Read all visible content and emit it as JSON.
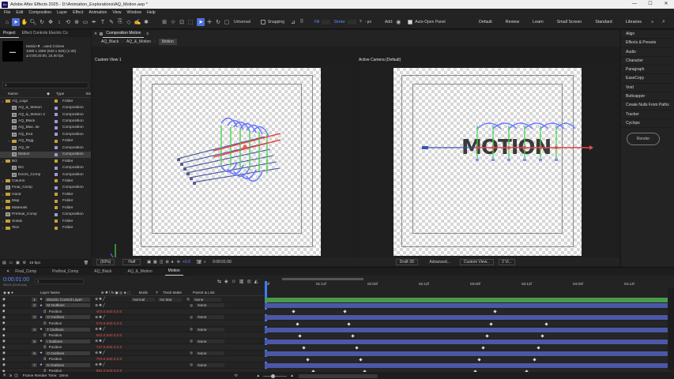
{
  "title_bar": {
    "app_badge": "Ae",
    "title": "Adobe After Effects 2025 - D:\\Animation_Explorations\\AQ_Motion.aep *",
    "controls": [
      "—",
      "☐",
      "✕"
    ]
  },
  "menu": [
    "File",
    "Edit",
    "Composition",
    "Layer",
    "Effect",
    "Animation",
    "View",
    "Window",
    "Help"
  ],
  "toolbar": {
    "universal": "Universal",
    "snapping": "Snapping",
    "fill": "Fill",
    "stroke": "Stroke",
    "stroke_help": "?",
    "stroke_px": "- px",
    "add": "Add:",
    "auto_open": "Auto-Open Panel",
    "workspaces": [
      "Default",
      "Review",
      "Learn",
      "Small Screen",
      "Standard",
      "Libraries"
    ],
    "more": "»"
  },
  "project_panel": {
    "tabs": [
      "Project",
      "Effect Controls Electric Co"
    ],
    "thumb_name": "Motion▼ , used 3 times",
    "thumb_size": "1080 x 1080 (540 x 540) (1.00)",
    "thumb_duration": "Δ 0:00:20:00, 24.00 fps",
    "columns": [
      "Name",
      "Type",
      "Siz"
    ],
    "items": [
      {
        "name": "AQ_Logo",
        "type": "Folder",
        "kind": "folder",
        "indent": 0
      },
      {
        "name": "AQ_&_Motion",
        "type": "Composition",
        "kind": "comp",
        "indent": 1
      },
      {
        "name": "AQ_&_Motion 2",
        "type": "Composition",
        "kind": "comp",
        "indent": 1
      },
      {
        "name": "AQ_Black",
        "type": "Composition",
        "kind": "comp",
        "indent": 1
      },
      {
        "name": "AQ_Blac..ite",
        "type": "Composition",
        "kind": "comp",
        "indent": 1
      },
      {
        "name": "AQ_End",
        "type": "Composition",
        "kind": "comp",
        "indent": 1
      },
      {
        "name": "AQ_Rigg",
        "type": "Folder",
        "kind": "folder",
        "indent": 1
      },
      {
        "name": "AQ_W",
        "type": "Composition",
        "kind": "comp",
        "indent": 1
      },
      {
        "name": "Motion",
        "type": "Composition",
        "kind": "comp",
        "indent": 1,
        "selected": true
      },
      {
        "name": "BG",
        "type": "Folder",
        "kind": "folder",
        "indent": 0
      },
      {
        "name": "BG",
        "type": "Composition",
        "kind": "comp",
        "indent": 1
      },
      {
        "name": "Doors_Comp",
        "type": "Composition",
        "kind": "comp",
        "indent": 1
      },
      {
        "name": "Column",
        "type": "Folder",
        "kind": "folder",
        "indent": 0
      },
      {
        "name": "Final_Comp",
        "type": "Composition",
        "kind": "comp",
        "indent": 0
      },
      {
        "name": "Hand",
        "type": "Folder",
        "kind": "folder",
        "indent": 0
      },
      {
        "name": "Map",
        "type": "Folder",
        "kind": "folder",
        "indent": 0
      },
      {
        "name": "Materials",
        "type": "Folder",
        "kind": "folder",
        "indent": 0
      },
      {
        "name": "Prefinal_Comp",
        "type": "Composition",
        "kind": "comp",
        "indent": 0
      },
      {
        "name": "Solids",
        "type": "Folder",
        "kind": "folder",
        "indent": 0
      },
      {
        "name": "Text",
        "type": "Folder",
        "kind": "folder",
        "indent": 0
      }
    ],
    "bpc": "16 bpc"
  },
  "comp_panel": {
    "tab": "Composition Motion",
    "breadcrumbs": [
      "AQ_Black",
      "AQ_&_Motion",
      "Motion"
    ],
    "view1": "Custom View 1",
    "view2": "Active Camera (Default)",
    "motion_text": "MOTION",
    "zoom": "(50%)",
    "resolution": "Half",
    "exposure": "+0.0",
    "timecode": "0:00:01:00",
    "renderer": "Draft 3D",
    "advanced": "Advanced...",
    "custom_view": "Custom View...",
    "views_count": "2 Vi..."
  },
  "right_panel": {
    "items": [
      "Align",
      "Effects & Presets",
      "Audio",
      "Character",
      "Paragraph",
      "EaseCopy",
      "Void",
      "Buttcapper",
      "Create Nulls From Paths",
      "Tracker",
      "Cyclops"
    ],
    "render": "Render"
  },
  "timeline": {
    "tabs": [
      "Final_Comp",
      "Prefinal_Comp",
      "AQ_Black",
      "AQ_&_Motion",
      "Motion"
    ],
    "timecode": "0:00:01:00",
    "fps": "00024 (24.00 fps)",
    "search_placeholder": "",
    "headers": {
      "layer_name": "Layer Name",
      "mode": "Mode",
      "track_matte": "Track Matte",
      "parent": "Parent & Link"
    },
    "ruler": [
      "00f",
      "01:12f",
      "02:00f",
      "02:12f",
      "03:00f",
      "03:12f",
      "04:00f",
      "04:12f"
    ],
    "layers": [
      {
        "num": "1",
        "name": "Electric Control Layer",
        "mode": "Normal",
        "matte": "No Mat",
        "parent": "None",
        "kind": "layer",
        "track": "green"
      },
      {
        "num": "2",
        "name": "M Outlines",
        "parent": "None",
        "kind": "layer",
        "track": "blue"
      },
      {
        "num": "",
        "name": "Position",
        "value": "403.0,540.0,0.0",
        "kind": "prop",
        "keys": [
          370,
          435,
          625
        ]
      },
      {
        "num": "3",
        "name": "O Outlines",
        "parent": "None",
        "kind": "layer",
        "track": "blue"
      },
      {
        "num": "",
        "name": "Position",
        "value": "578.9,540.0,0.0",
        "kind": "prop",
        "keys": [
          375,
          440,
          620,
          690
        ]
      },
      {
        "num": "4",
        "name": "T Outlines",
        "parent": "None",
        "kind": "layer",
        "track": "blue"
      },
      {
        "num": "",
        "name": "Position",
        "value": "663.0,540.0,0.0",
        "kind": "prop",
        "keys": [
          378,
          445,
          615,
          685
        ]
      },
      {
        "num": "5",
        "name": "I Outlines",
        "parent": "None",
        "kind": "layer",
        "track": "blue"
      },
      {
        "num": "",
        "name": "Position",
        "value": "727.0,540.0,0.0",
        "kind": "prop",
        "keys": [
          383,
          450,
          610,
          680
        ]
      },
      {
        "num": "6",
        "name": "O Outlines",
        "parent": "None",
        "kind": "layer",
        "track": "blue"
      },
      {
        "num": "",
        "name": "Position",
        "value": "793.0,540.0,0.0",
        "kind": "prop",
        "keys": [
          388,
          455,
          605,
          675
        ]
      },
      {
        "num": "7",
        "name": "N Outlines",
        "parent": "None",
        "kind": "layer",
        "track": "blue"
      },
      {
        "num": "",
        "name": "Position",
        "value": "894.0,540.0,0.0",
        "kind": "prop",
        "keys": [
          395,
          460,
          600,
          665
        ]
      }
    ],
    "frame_render": "Frame Render Time:",
    "frame_render_value": "18ms"
  }
}
